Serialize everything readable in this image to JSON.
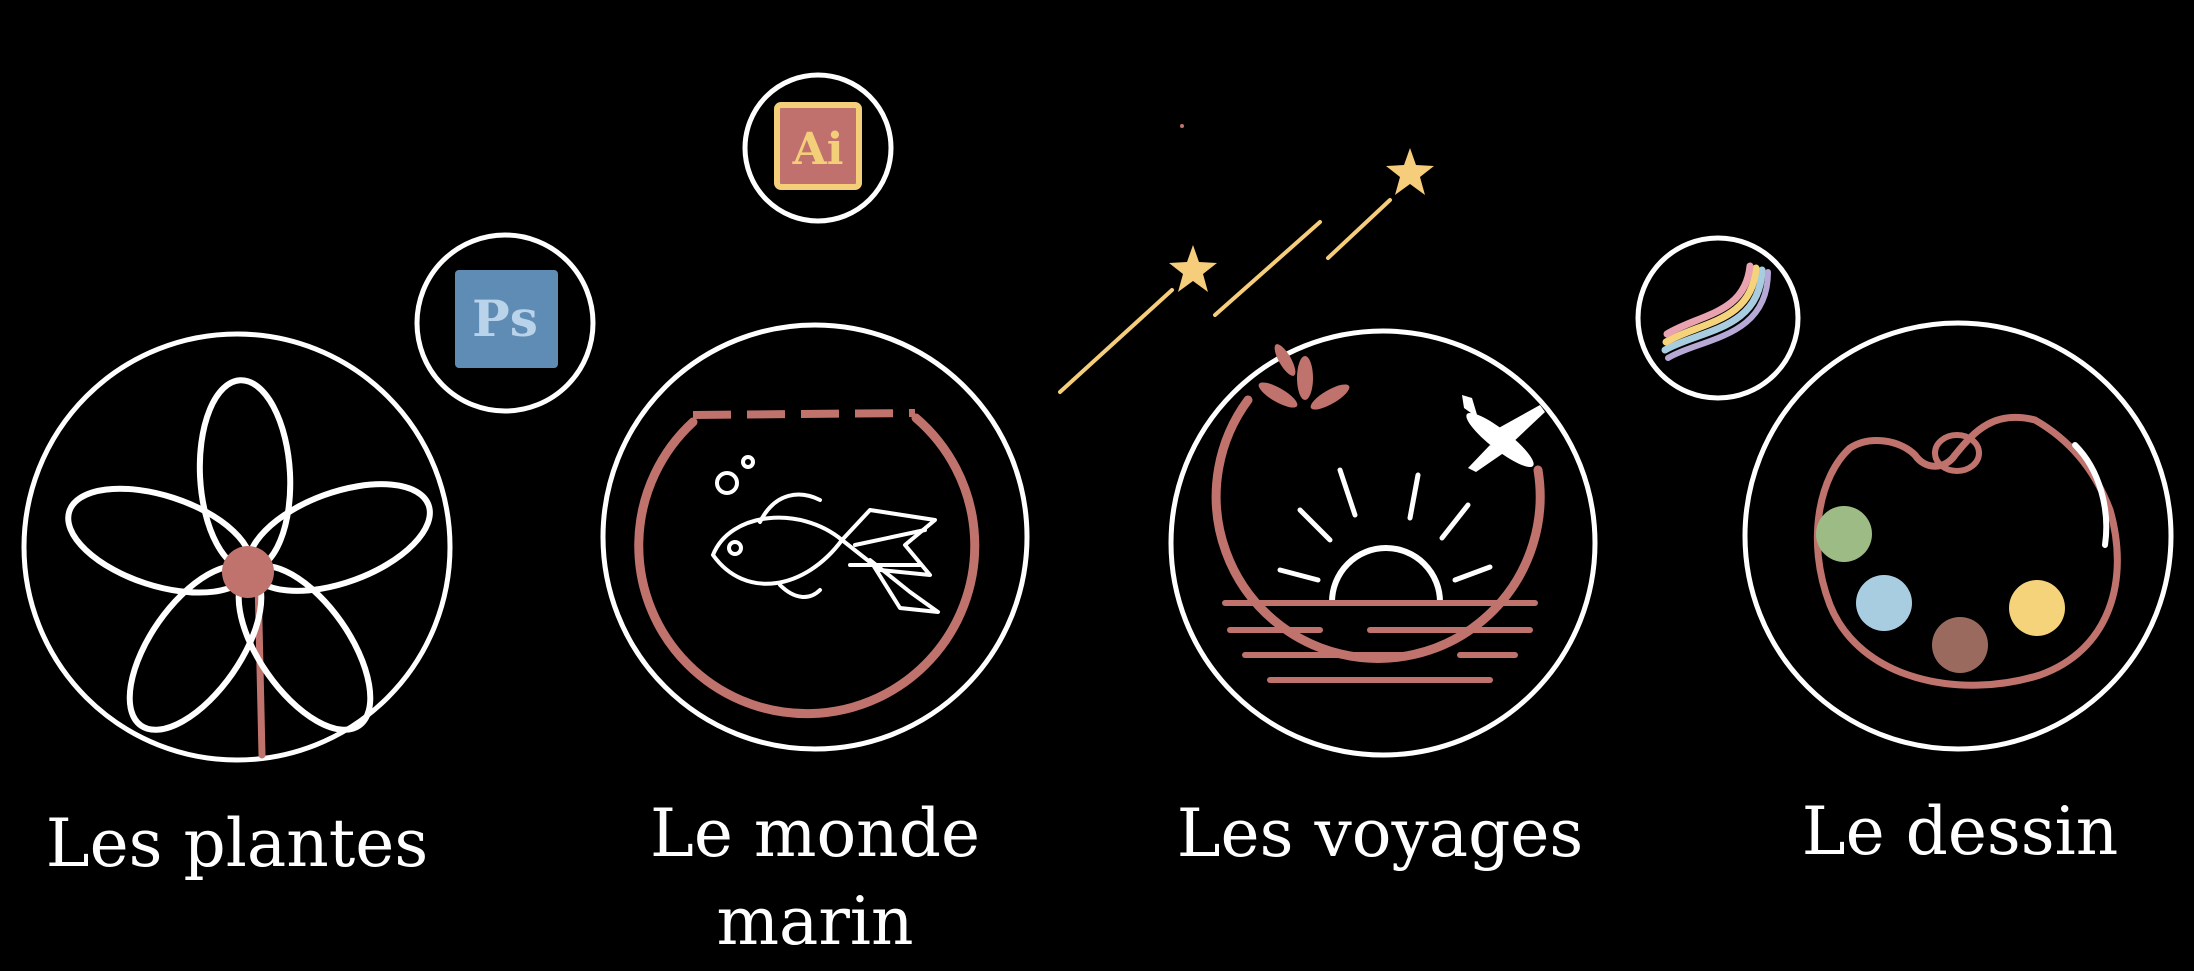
{
  "items": [
    {
      "label": "Les plantes",
      "icon": "flower-icon"
    },
    {
      "label": "Le monde marin",
      "icon": "fishbowl-icon"
    },
    {
      "label": "Les voyages",
      "icon": "sunset-travel-icon"
    },
    {
      "label": "Le dessin",
      "icon": "paint-palette-icon"
    }
  ],
  "badges": {
    "photoshop": {
      "text": "Ps",
      "icon": "photoshop-icon",
      "color": "#5f8cb4",
      "text_color": "#b9d4ea"
    },
    "illustrator": {
      "text": "Ai",
      "icon": "illustrator-icon",
      "color": "#c0716d",
      "text_color": "#f3cf7a"
    },
    "rainbow": {
      "icon": "rainbow-brush-icon"
    }
  },
  "colors": {
    "background": "#000000",
    "outline": "#ffffff",
    "accent": "#c0736d",
    "star": "#f6cd7a",
    "palette_green": "#9dbb85",
    "palette_blue": "#a9cde0",
    "palette_brown": "#9a6a5e",
    "palette_yellow": "#f5d37a"
  }
}
